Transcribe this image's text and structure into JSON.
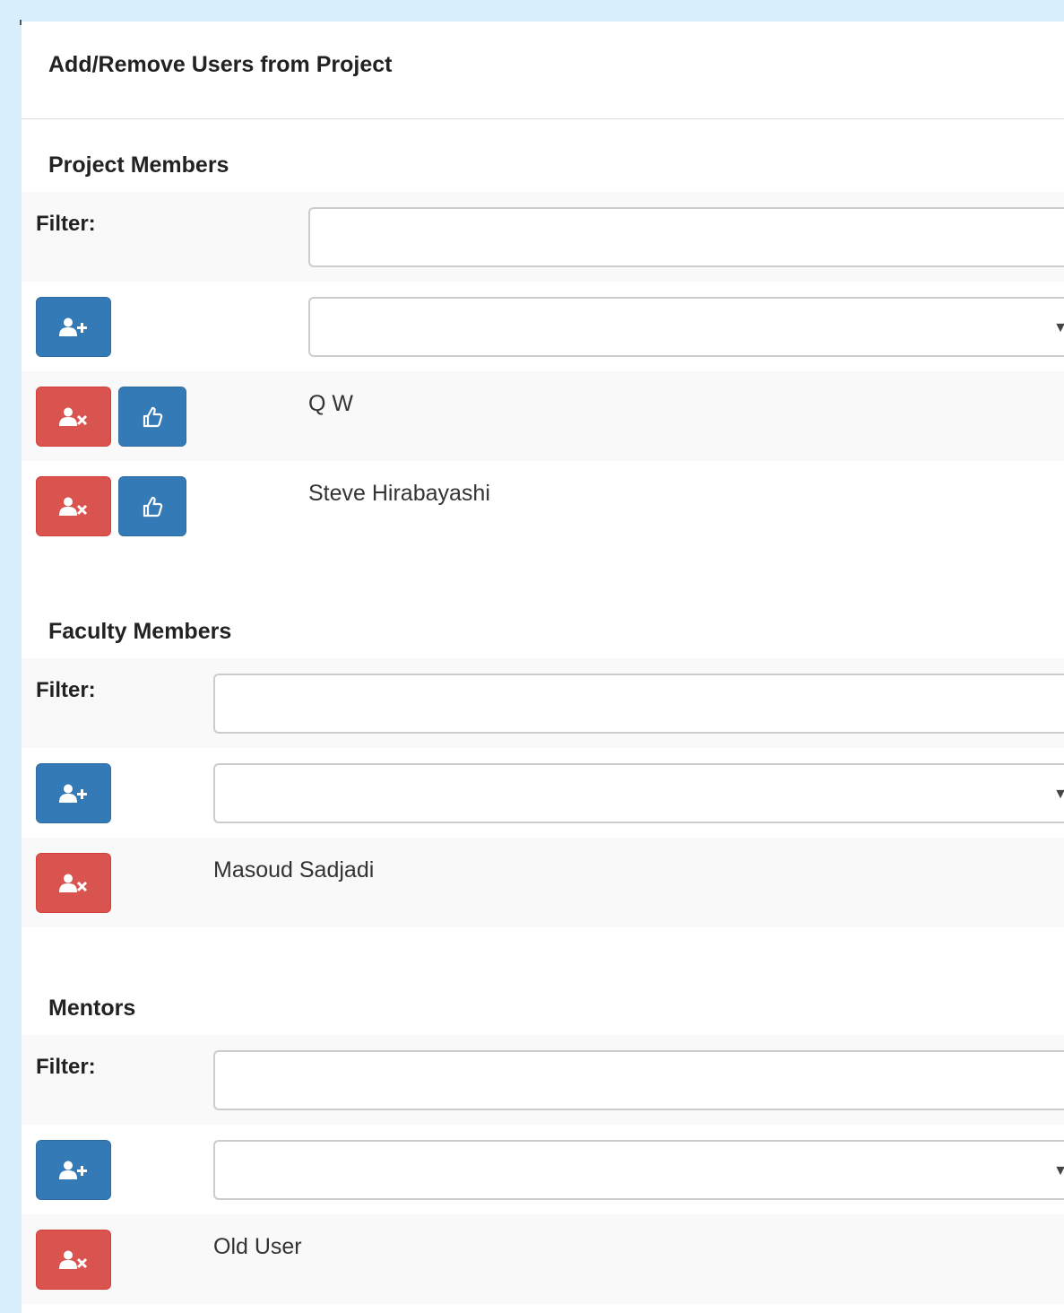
{
  "panel": {
    "title": "Add/Remove Users from Project"
  },
  "project_members": {
    "title": "Project Members",
    "filter_label": "Filter:",
    "filter_value": "",
    "select_value": "",
    "members": [
      "Q W",
      "Steve Hirabayashi"
    ]
  },
  "faculty_members": {
    "title": "Faculty Members",
    "filter_label": "Filter:",
    "filter_value": "",
    "select_value": "",
    "members": [
      "Masoud Sadjadi"
    ]
  },
  "mentors": {
    "title": "Mentors",
    "filter_label": "Filter:",
    "filter_value": "",
    "select_value": "",
    "members": [
      "Old User"
    ]
  },
  "icons": {
    "add": "user-plus-icon",
    "remove": "user-times-icon",
    "approve": "thumbs-up-icon",
    "dropdown": "caret-down-icon"
  },
  "colors": {
    "primary": "#337ab7",
    "danger": "#d9534f",
    "page_bg": "#d9eefc"
  }
}
